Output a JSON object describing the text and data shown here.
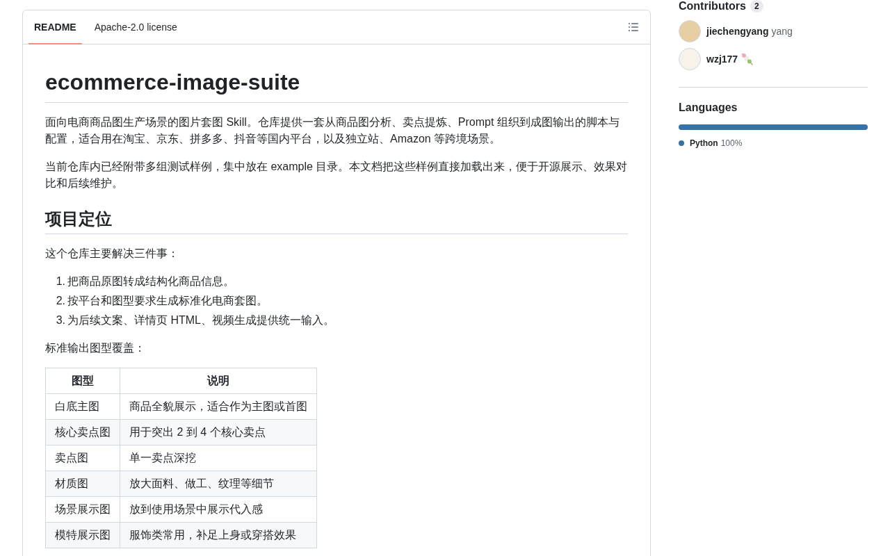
{
  "readme": {
    "tabs": [
      {
        "label": "README",
        "selected": true
      },
      {
        "label": "Apache-2.0 license",
        "selected": false
      }
    ],
    "content": [
      {
        "kind": "h1",
        "text": "ecommerce-image-suite"
      },
      {
        "kind": "p",
        "text": "面向电商商品图生产场景的图片套图 Skill。仓库提供一套从商品图分析、卖点提炼、Prompt 组织到成图输出的脚本与配置，适合用在淘宝、京东、拼多多、抖音等国内平台，以及独立站、Amazon 等跨境场景。"
      },
      {
        "kind": "p",
        "text": "当前仓库内已经附带多组测试样例，集中放在 example 目录。本文档把这些样例直接加载出来，便于开源展示、效果对比和后续维护。"
      },
      {
        "kind": "h2",
        "text": "项目定位"
      },
      {
        "kind": "p",
        "text": "这个仓库主要解决三件事："
      },
      {
        "kind": "ol",
        "items": [
          {
            "marker": "1.",
            "text": "把商品原图转成结构化商品信息。"
          },
          {
            "marker": "2.",
            "text": "按平台和图型要求生成标准化电商套图。"
          },
          {
            "marker": "3.",
            "text": "为后续文案、详情页 HTML、视频生成提供统一输入。"
          }
        ]
      },
      {
        "kind": "p",
        "text": "标准输出图型覆盖："
      },
      {
        "kind": "table",
        "columns": [
          "图型",
          "说明"
        ],
        "rows": [
          [
            "白底主图",
            "商品全貌展示，适合作为主图或首图"
          ],
          [
            "核心卖点图",
            "用于突出 2 到 4 个核心卖点"
          ],
          [
            "卖点图",
            "单一卖点深挖"
          ],
          [
            "材质图",
            "放大面料、做工、纹理等细节"
          ],
          [
            "场景展示图",
            "放到使用场景中展示代入感"
          ],
          [
            "模特展示图",
            "服饰类常用，补足上身或穿搭效果"
          ]
        ]
      }
    ]
  },
  "sidebar": {
    "contributors": {
      "title": "Contributors",
      "count": "2",
      "people": [
        {
          "kind": "text_name",
          "login": "jiechengyang",
          "name": "yang"
        },
        {
          "kind": "emoji_name",
          "login": "wzj177"
        }
      ]
    },
    "languages": {
      "title": "Languages",
      "items": [
        {
          "name": "Python",
          "percent": "100%",
          "color": "#3572a5",
          "level": 1
        }
      ]
    }
  }
}
